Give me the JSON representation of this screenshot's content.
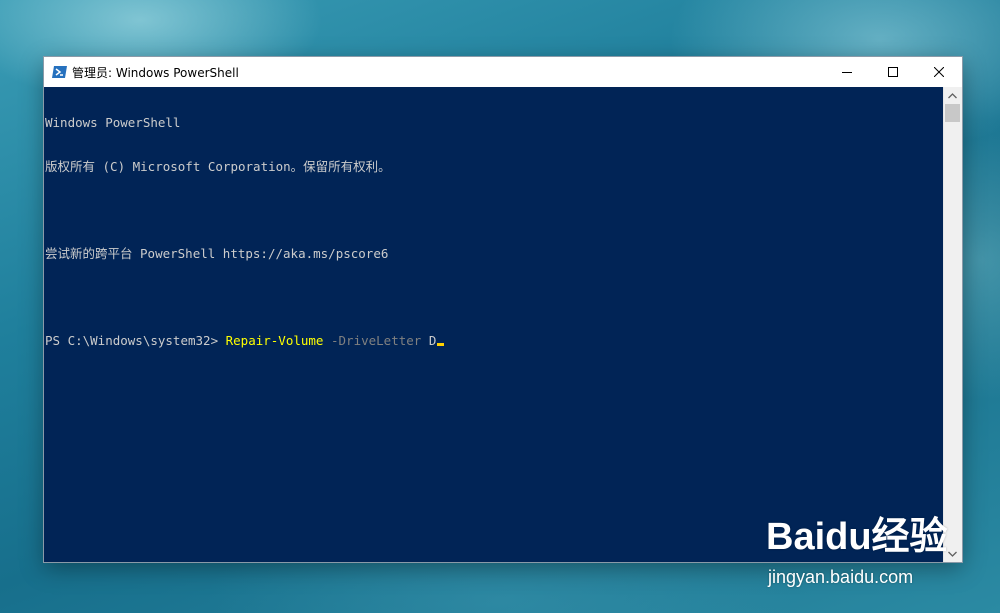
{
  "window": {
    "title": "管理员: Windows PowerShell"
  },
  "console": {
    "line1": "Windows PowerShell",
    "line2": "版权所有 (C) Microsoft Corporation。保留所有权利。",
    "line3": "尝试新的跨平台 PowerShell https://aka.ms/pscore6",
    "prompt": "PS C:\\Windows\\system32> ",
    "command": "Repair-Volume",
    "parameter": " -DriveLetter",
    "argument": " D"
  },
  "colors": {
    "console_background": "#012456",
    "console_text": "#cccccc",
    "command": "#ffff00",
    "parameter": "#808080",
    "cursor": "#ffd000"
  },
  "icons": {
    "app": "powershell-icon",
    "minimize": "minimize-icon",
    "maximize": "maximize-icon",
    "close": "close-icon",
    "scroll_up": "chevron-up-icon",
    "scroll_down": "chevron-down-icon"
  },
  "watermark": {
    "logo": "Baidu经验",
    "url": "jingyan.baidu.com"
  }
}
